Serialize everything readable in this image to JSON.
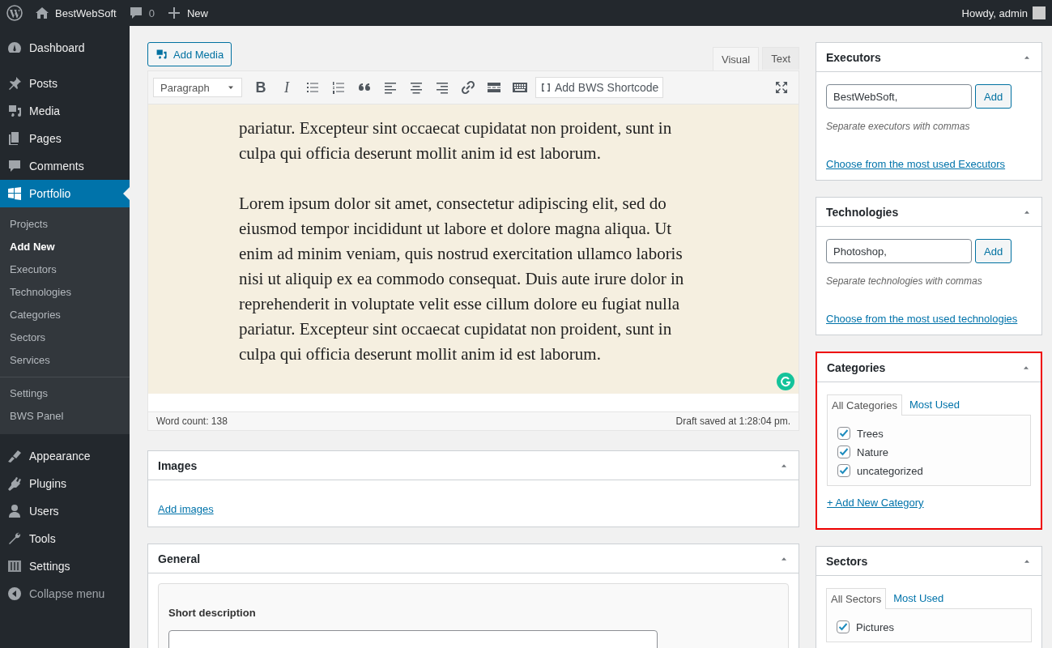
{
  "admin_bar": {
    "site_name": "BestWebSoft",
    "comments_count": "0",
    "new_label": "New",
    "greeting": "Howdy, admin"
  },
  "sidebar": {
    "items": [
      {
        "label": "Dashboard",
        "selected": false
      },
      {
        "label": "Posts",
        "selected": false
      },
      {
        "label": "Media",
        "selected": false
      },
      {
        "label": "Pages",
        "selected": false
      },
      {
        "label": "Comments",
        "selected": false
      },
      {
        "label": "Portfolio",
        "selected": true,
        "submenu": [
          [
            {
              "label": "Projects",
              "selected": false
            },
            {
              "label": "Add New",
              "selected": true
            },
            {
              "label": "Executors",
              "selected": false
            },
            {
              "label": "Technologies",
              "selected": false
            },
            {
              "label": "Categories",
              "selected": false
            },
            {
              "label": "Sectors",
              "selected": false
            },
            {
              "label": "Services",
              "selected": false
            }
          ],
          [
            {
              "label": "Settings",
              "selected": false
            },
            {
              "label": "BWS Panel",
              "selected": false
            }
          ]
        ]
      },
      {
        "label": "Appearance",
        "selected": false
      },
      {
        "label": "Plugins",
        "selected": false
      },
      {
        "label": "Users",
        "selected": false
      },
      {
        "label": "Tools",
        "selected": false
      },
      {
        "label": "Settings",
        "selected": false
      }
    ],
    "collapse_label": "Collapse menu"
  },
  "editor": {
    "add_media_label": "Add Media",
    "tabs": [
      {
        "label": "Visual",
        "selected": true
      },
      {
        "label": "Text",
        "selected": false
      }
    ],
    "toolbar": {
      "format": "Paragraph",
      "bold_glyph": "B",
      "italic_glyph": "I",
      "shortcode_label": "Add BWS Shortcode"
    },
    "paragraphs": [
      "pariatur. Excepteur sint occaecat cupidatat non proident, sunt in culpa qui officia deserunt mollit anim id est laborum.",
      "Lorem ipsum dolor sit amet, consectetur adipiscing elit, sed do eiusmod tempor incididunt ut labore et dolore magna aliqua. Ut enim ad minim veniam, quis nostrud exercitation ullamco laboris nisi ut aliquip ex ea commodo consequat. Duis aute irure dolor in reprehenderit in voluptate velit esse cillum dolore eu fugiat nulla pariatur. Excepteur sint occaecat cupidatat non proident, sunt in culpa qui officia deserunt mollit anim id est laborum."
    ],
    "word_count": "Word count: 138",
    "draft_status": "Draft saved at 1:28:04 pm."
  },
  "images_box": {
    "title": "Images",
    "link": "Add images"
  },
  "general_box": {
    "title": "General",
    "field_label": "Short description"
  },
  "executors": {
    "title": "Executors",
    "value": "BestWebSoft,",
    "button": "Add",
    "hint": "Separate executors with commas",
    "link": "Choose from the most used Executors"
  },
  "technologies": {
    "title": "Technologies",
    "value": "Photoshop,",
    "button": "Add",
    "hint": "Separate technologies with commas",
    "link": "Choose from the most used technologies"
  },
  "categories": {
    "title": "Categories",
    "highlighted": true,
    "tabs": [
      {
        "label": "All Categories",
        "selected": true
      },
      {
        "label": "Most Used",
        "selected": false
      }
    ],
    "items": [
      {
        "label": "Trees",
        "checked": true
      },
      {
        "label": "Nature",
        "checked": true
      },
      {
        "label": "uncategorized",
        "checked": true
      }
    ],
    "add_link": "+ Add New Category"
  },
  "sectors": {
    "title": "Sectors",
    "tabs": [
      {
        "label": "All Sectors",
        "selected": true
      },
      {
        "label": "Most Used",
        "selected": false
      }
    ],
    "items": [
      {
        "label": "Pictures",
        "checked": true
      }
    ]
  }
}
